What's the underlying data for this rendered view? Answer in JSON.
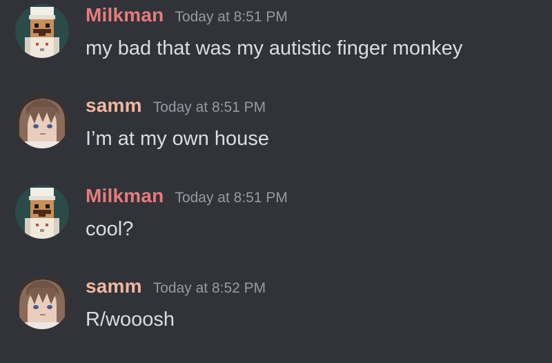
{
  "colors": {
    "background": "#313338",
    "milkman_name": "#e67c7c",
    "samm_name": "#f0b8a0",
    "timestamp": "#949ba4",
    "message_text": "#dbdee1"
  },
  "messages": [
    {
      "username": "Milkman",
      "timestamp": "Today at 8:51 PM",
      "content": "my bad that was my autistic finger monkey",
      "avatar": "pixel-chef-avatar"
    },
    {
      "username": "samm",
      "timestamp": "Today at 8:51 PM",
      "content": "I’m at my own house",
      "avatar": "anime-girl-avatar"
    },
    {
      "username": "Milkman",
      "timestamp": "Today at 8:51 PM",
      "content": "cool?",
      "avatar": "pixel-chef-avatar"
    },
    {
      "username": "samm",
      "timestamp": "Today at 8:52 PM",
      "content": "R/wooosh",
      "avatar": "anime-girl-avatar"
    }
  ]
}
